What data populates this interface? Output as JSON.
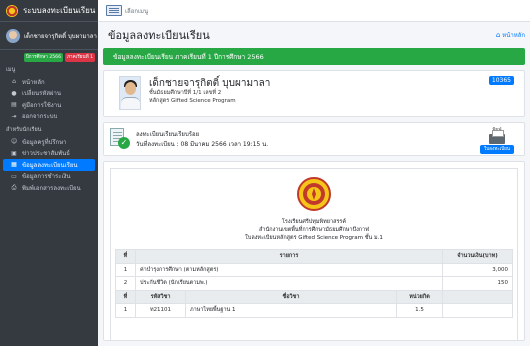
{
  "sidebar": {
    "brand": "ระบบลงทะเบียนเรียน",
    "user_name": "เด็กชายจารุกิตติ์ บุบผามาลา",
    "badge_year": "ปีการศึกษา 2566",
    "badge_term": "ภาคเรียนที่ 1",
    "section_menu": "เมนู",
    "section_student": "สำหรับนักเรียน",
    "menu": [
      {
        "label": "หน้าหลัก",
        "icon": "home-icon"
      },
      {
        "label": "เปลี่ยนรหัสผ่าน",
        "icon": "user-icon"
      },
      {
        "label": "คู่มือการใช้งาน",
        "icon": "book-icon"
      },
      {
        "label": "ออกจากระบบ",
        "icon": "logout-icon"
      }
    ],
    "student_menu": [
      {
        "label": "ข้อมูลครูที่ปรึกษา",
        "icon": "teacher-icon"
      },
      {
        "label": "ข่าวประชาสัมพันธ์",
        "icon": "news-icon"
      },
      {
        "label": "ข้อมูลลงทะเบียนเรียน",
        "icon": "register-icon",
        "active": true
      },
      {
        "label": "ข้อมูลการชำระเงิน",
        "icon": "payment-icon"
      },
      {
        "label": "พิมพ์เอกสารลงทะเบียน",
        "icon": "print-icon"
      }
    ]
  },
  "topbar": {
    "menu_label": "เลือกเมนู"
  },
  "page": {
    "title": "ข้อมูลลงทะเบียนเรียน",
    "breadcrumb": "หน้าหลัก",
    "alert": "ข้อมูลลงทะเบียนเรียน ภาคเรียนที่ 1 ปีการศึกษา 2566"
  },
  "profile": {
    "name": "เด็กชายจารุกิตติ์ บุบผามาลา",
    "class": "ชั้นมัธยมศึกษาปีที่ 1/1 เลขที่ 2",
    "program": "หลักสูตร Gifted Science Program",
    "student_id": "10365"
  },
  "status": {
    "message": "ลงทะเบียนเรียนเรียบร้อย",
    "date": "วันที่ลงทะเบียน : 08 มีนาคม 2566 เวลา 19:15 น.",
    "print_label": "พิมพ์",
    "print_button": "ใบลงทะเบียน"
  },
  "receipt": {
    "school": "โรงเรียนศรีปทุมพิทยาสรรค์",
    "office": "สำนักงานเขตพื้นที่การศึกษามัธยมศึกษาบึงกาฬ",
    "doc_title": "ใบลงทะเบียนหลักสูตร Gifted Science Program ชั้น ม.1",
    "fees_headers": [
      "ที่",
      "รายการ",
      "จำนวนเงิน(บาท)"
    ],
    "fees": [
      {
        "no": "1",
        "item": "ค่าบำรุงการศึกษา (ตามหลักสูตร)",
        "amount": "3,000"
      },
      {
        "no": "2",
        "item": "ประกันชีวิต (นักเรียนตามพ.)",
        "amount": "150"
      }
    ],
    "subject_headers": [
      "ที่",
      "รหัสวิชา",
      "ชื่อวิชา",
      "หน่วยกิต"
    ],
    "subjects": [
      {
        "no": "1",
        "code": "ท21101",
        "name": "ภาษาไทยพื้นฐาน 1",
        "credit": "1.5"
      }
    ]
  }
}
